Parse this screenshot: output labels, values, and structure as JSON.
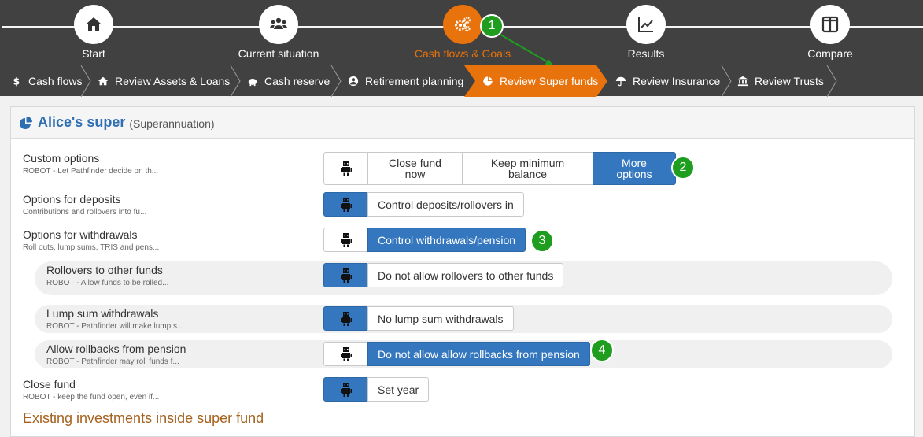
{
  "steps": [
    {
      "label": "Start",
      "icon": "home-icon"
    },
    {
      "label": "Current situation",
      "icon": "users-icon"
    },
    {
      "label": "Cash flows & Goals",
      "icon": "gears-icon",
      "active": true
    },
    {
      "label": "Results",
      "icon": "line-chart-icon"
    },
    {
      "label": "Compare",
      "icon": "columns-icon"
    }
  ],
  "subnav": [
    {
      "label": "Cash flows",
      "icon": "dollar-icon"
    },
    {
      "label": "Review Assets & Loans",
      "icon": "home-icon"
    },
    {
      "label": "Cash reserve",
      "icon": "piggy-bank-icon"
    },
    {
      "label": "Retirement planning",
      "icon": "user-circle-icon"
    },
    {
      "label": "Review Super funds",
      "icon": "pie-chart-icon",
      "active": true
    },
    {
      "label": "Review Insurance",
      "icon": "umbrella-icon"
    },
    {
      "label": "Review Trusts",
      "icon": "bank-icon"
    }
  ],
  "panel": {
    "title": "Alice's super",
    "subtitle": "(Superannuation)"
  },
  "rows": [
    {
      "label": "Custom options",
      "desc": "ROBOT - Let Pathfinder decide on th...",
      "options": [
        "Close fund now",
        "Keep minimum balance",
        "More options"
      ],
      "selected": "More options"
    },
    {
      "label": "Options for deposits",
      "desc": "Contributions and rollovers into fu...",
      "options": [
        "Control deposits/rollovers in"
      ],
      "selected": "robot"
    },
    {
      "label": "Options for withdrawals",
      "desc": "Roll outs, lump sums, TRIS and pens...",
      "options": [
        "Control withdrawals/pension"
      ],
      "selected": "Control withdrawals/pension"
    },
    {
      "label": "Rollovers to other funds",
      "desc": "ROBOT - Allow funds to be rolled...",
      "options": [
        "Do not allow rollovers to other funds"
      ],
      "selected": "robot"
    },
    {
      "label": "Lump sum withdrawals",
      "desc": "ROBOT - Pathfinder will make lump s...",
      "options": [
        "No lump sum withdrawals"
      ],
      "selected": "robot"
    },
    {
      "label": "Allow rollbacks from pension",
      "desc": "ROBOT - Pathfinder may roll funds f...",
      "options": [
        "Do not allow allow rollbacks from pension"
      ],
      "selected": "Do not allow allow rollbacks from pension"
    },
    {
      "label": "Close fund",
      "desc": "ROBOT - keep the fund open, even if...",
      "options": [
        "Set year"
      ],
      "selected": "robot"
    }
  ],
  "section_title": "Existing investments inside super fund",
  "badges": [
    "1",
    "2",
    "3",
    "4"
  ],
  "colors": {
    "active_orange": "#e8720c",
    "selected_blue": "#3477be",
    "badge_green": "#1e9d1e",
    "dark_bar": "#414141"
  }
}
